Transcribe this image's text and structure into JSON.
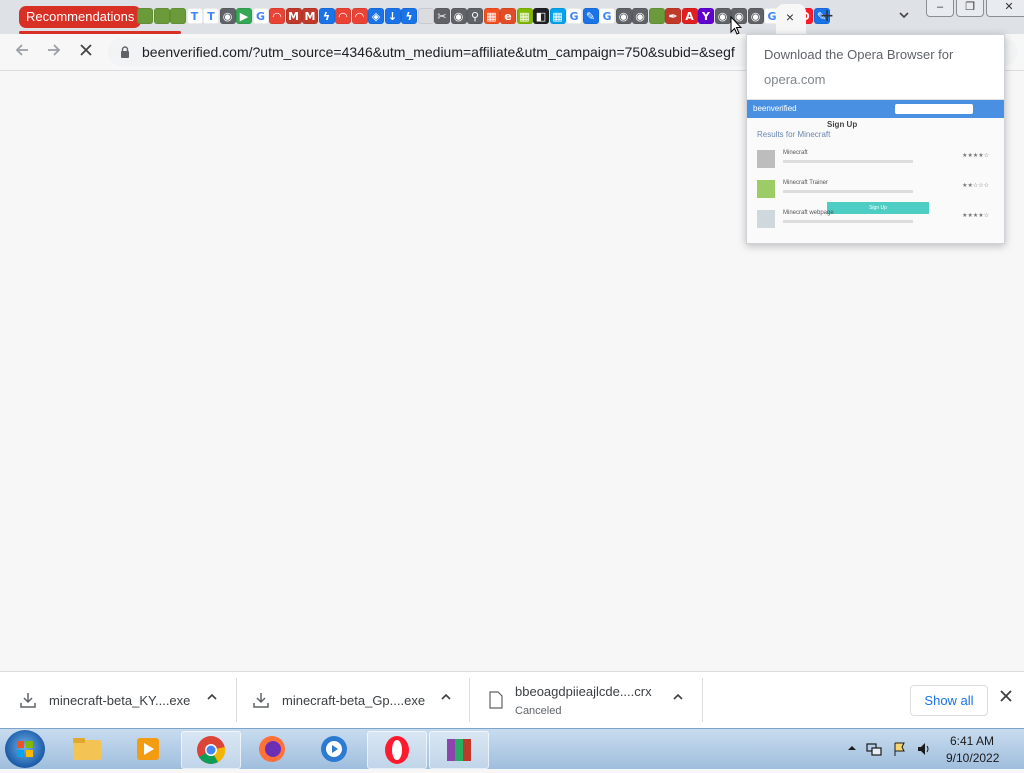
{
  "tab_strip": {
    "tab_group_label": "Recommendations",
    "favicons": [
      {
        "icon": "minecraft-icon",
        "color": "#6a9a3a",
        "glyph": ""
      },
      {
        "icon": "minecraft-icon",
        "color": "#6a9a3a",
        "glyph": ""
      },
      {
        "icon": "minecraft-icon",
        "color": "#6a9a3a",
        "glyph": ""
      },
      {
        "icon": "text-t-icon",
        "color": "#ffffff",
        "glyph": "T"
      },
      {
        "icon": "text-t-icon",
        "color": "#ffffff",
        "glyph": "T"
      },
      {
        "icon": "globe-icon",
        "color": "#5f6368",
        "glyph": "◉"
      },
      {
        "icon": "play-store-icon",
        "color": "#34a853",
        "glyph": "▶"
      },
      {
        "icon": "google-icon",
        "color": "#ffffff",
        "glyph": "G"
      },
      {
        "icon": "rainbow-icon",
        "color": "#ea4335",
        "glyph": "◠"
      },
      {
        "icon": "mario-icon",
        "color": "#c0392b",
        "glyph": "M"
      },
      {
        "icon": "mario-icon",
        "color": "#c0392b",
        "glyph": "M"
      },
      {
        "icon": "bolt-icon",
        "color": "#1a73e8",
        "glyph": "ϟ"
      },
      {
        "icon": "rainbow-icon",
        "color": "#ea4335",
        "glyph": "◠"
      },
      {
        "icon": "rainbow-icon",
        "color": "#ea4335",
        "glyph": "◠"
      },
      {
        "icon": "shield-icon",
        "color": "#1a73e8",
        "glyph": "◈"
      },
      {
        "icon": "download-icon",
        "color": "#1a73e8",
        "glyph": "↓"
      },
      {
        "icon": "bolt-icon",
        "color": "#1a73e8",
        "glyph": "ϟ"
      },
      {
        "icon": "page-icon",
        "color": "#dadce0",
        "glyph": ""
      },
      {
        "icon": "tools-icon",
        "color": "#5f6368",
        "glyph": "✂"
      },
      {
        "icon": "globe-icon",
        "color": "#5f6368",
        "glyph": "◉"
      },
      {
        "icon": "search-icon",
        "color": "#5f6368",
        "glyph": "⚲"
      },
      {
        "icon": "microsoft-icon",
        "color": "#f25022",
        "glyph": "▦"
      },
      {
        "icon": "html5-icon",
        "color": "#e34c26",
        "glyph": "e"
      },
      {
        "icon": "microsoft-icon",
        "color": "#7fba00",
        "glyph": "▦"
      },
      {
        "icon": "black-app-icon",
        "color": "#202124",
        "glyph": "◧"
      },
      {
        "icon": "microsoft-icon",
        "color": "#00a4ef",
        "glyph": "▦"
      },
      {
        "icon": "google-icon",
        "color": "#ffffff",
        "glyph": "G"
      },
      {
        "icon": "edit-icon",
        "color": "#1a73e8",
        "glyph": "✎"
      },
      {
        "icon": "google-icon",
        "color": "#ffffff",
        "glyph": "G"
      },
      {
        "icon": "globe-icon",
        "color": "#5f6368",
        "glyph": "◉"
      },
      {
        "icon": "globe-icon",
        "color": "#5f6368",
        "glyph": "◉"
      },
      {
        "icon": "minecraft-icon",
        "color": "#6a9a3a",
        "glyph": ""
      },
      {
        "icon": "pen-icon",
        "color": "#c0392b",
        "glyph": "✒"
      },
      {
        "icon": "adobe-icon",
        "color": "#e02020",
        "glyph": "A"
      },
      {
        "icon": "yahoo-icon",
        "color": "#6001d2",
        "glyph": "Y"
      },
      {
        "icon": "globe-icon",
        "color": "#5f6368",
        "glyph": "◉"
      },
      {
        "icon": "globe-icon",
        "color": "#5f6368",
        "glyph": "◉"
      },
      {
        "icon": "globe-icon",
        "color": "#5f6368",
        "glyph": "◉"
      },
      {
        "icon": "google-icon",
        "color": "#ffffff",
        "glyph": "G"
      },
      {
        "icon": "download-icon",
        "color": "#1a73e8",
        "glyph": "↓"
      },
      {
        "icon": "opera-icon",
        "color": "#ff1b2d",
        "glyph": "O"
      },
      {
        "icon": "edit-icon",
        "color": "#1a73e8",
        "glyph": "✎"
      }
    ],
    "active_tab_close": "×",
    "new_tab": "+"
  },
  "toolbar": {
    "url": "beenverified.com/?utm_source=4346&utm_medium=affiliate&utm_campaign=750&subid=&segf"
  },
  "hover_card": {
    "title": "Download the Opera Browser for",
    "domain": "opera.com",
    "preview": {
      "logo": "beenverified",
      "heading": "Results for Minecraft",
      "signup": "Sign Up",
      "items": [
        {
          "name": "Minecraft",
          "stars": "★★★★☆"
        },
        {
          "name": "Minecraft Trainer",
          "stars": "★★☆☆☆"
        },
        {
          "name": "Minecraft webpage",
          "stars": "★★★★☆"
        }
      ],
      "button": "Sign Up"
    }
  },
  "downloads": [
    {
      "name": "minecraft-beta_KY....exe",
      "status": ""
    },
    {
      "name": "minecraft-beta_Gp....exe",
      "status": ""
    },
    {
      "name": "bbeoagdpiieajlcde....crx",
      "status": "Canceled"
    }
  ],
  "shelf": {
    "show_all": "Show all"
  },
  "taskbar": {
    "apps": [
      "file-explorer-icon",
      "media-player-icon",
      "chrome-icon",
      "firefox-icon",
      "avast-browser-icon",
      "opera-icon",
      "winrar-icon"
    ],
    "time": "6:41 AM",
    "date": "9/10/2022"
  },
  "colors": {
    "accent_red": "#d93025",
    "link_blue": "#1a73e8"
  }
}
